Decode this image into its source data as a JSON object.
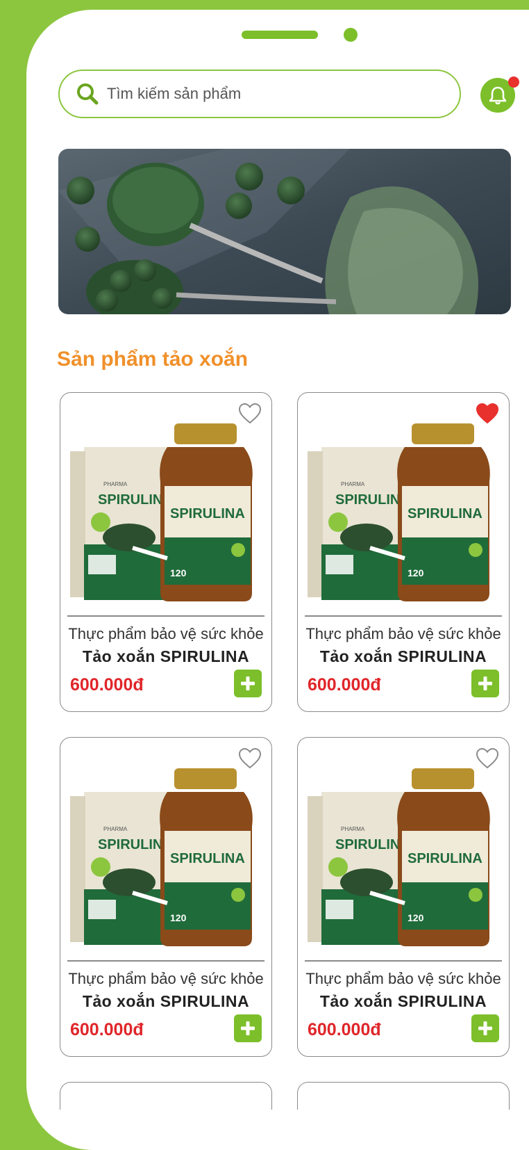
{
  "search": {
    "placeholder": "Tìm kiếm sản phẩm"
  },
  "section": {
    "title": "Sản phẩm tảo xoắn"
  },
  "products": [
    {
      "subtitle": "Thực phẩm bảo vệ sức khỏe",
      "name": "Tảo xoắn SPIRULINA",
      "price": "600.000đ",
      "favorite": false
    },
    {
      "subtitle": "Thực phẩm bảo vệ sức khỏe",
      "name": "Tảo xoắn SPIRULINA",
      "price": "600.000đ",
      "favorite": true
    },
    {
      "subtitle": "Thực phẩm bảo vệ sức khỏe",
      "name": "Tảo xoắn SPIRULINA",
      "price": "600.000đ",
      "favorite": false
    },
    {
      "subtitle": "Thực phẩm bảo vệ sức khỏe",
      "name": "Tảo xoắn SPIRULINA",
      "price": "600.000đ",
      "favorite": false
    }
  ],
  "packaging": {
    "brand": "PHARMA",
    "product": "SPIRULINA",
    "box_product": "SPIRULIN",
    "count": "120"
  },
  "colors": {
    "brand_green": "#7cbf2a",
    "accent_orange": "#f0902a",
    "price_red": "#e0262a",
    "heart_red": "#e8302d"
  },
  "icons": {
    "search": "search-icon",
    "bell": "bell-icon",
    "heart": "heart-icon",
    "add": "plus-icon"
  }
}
